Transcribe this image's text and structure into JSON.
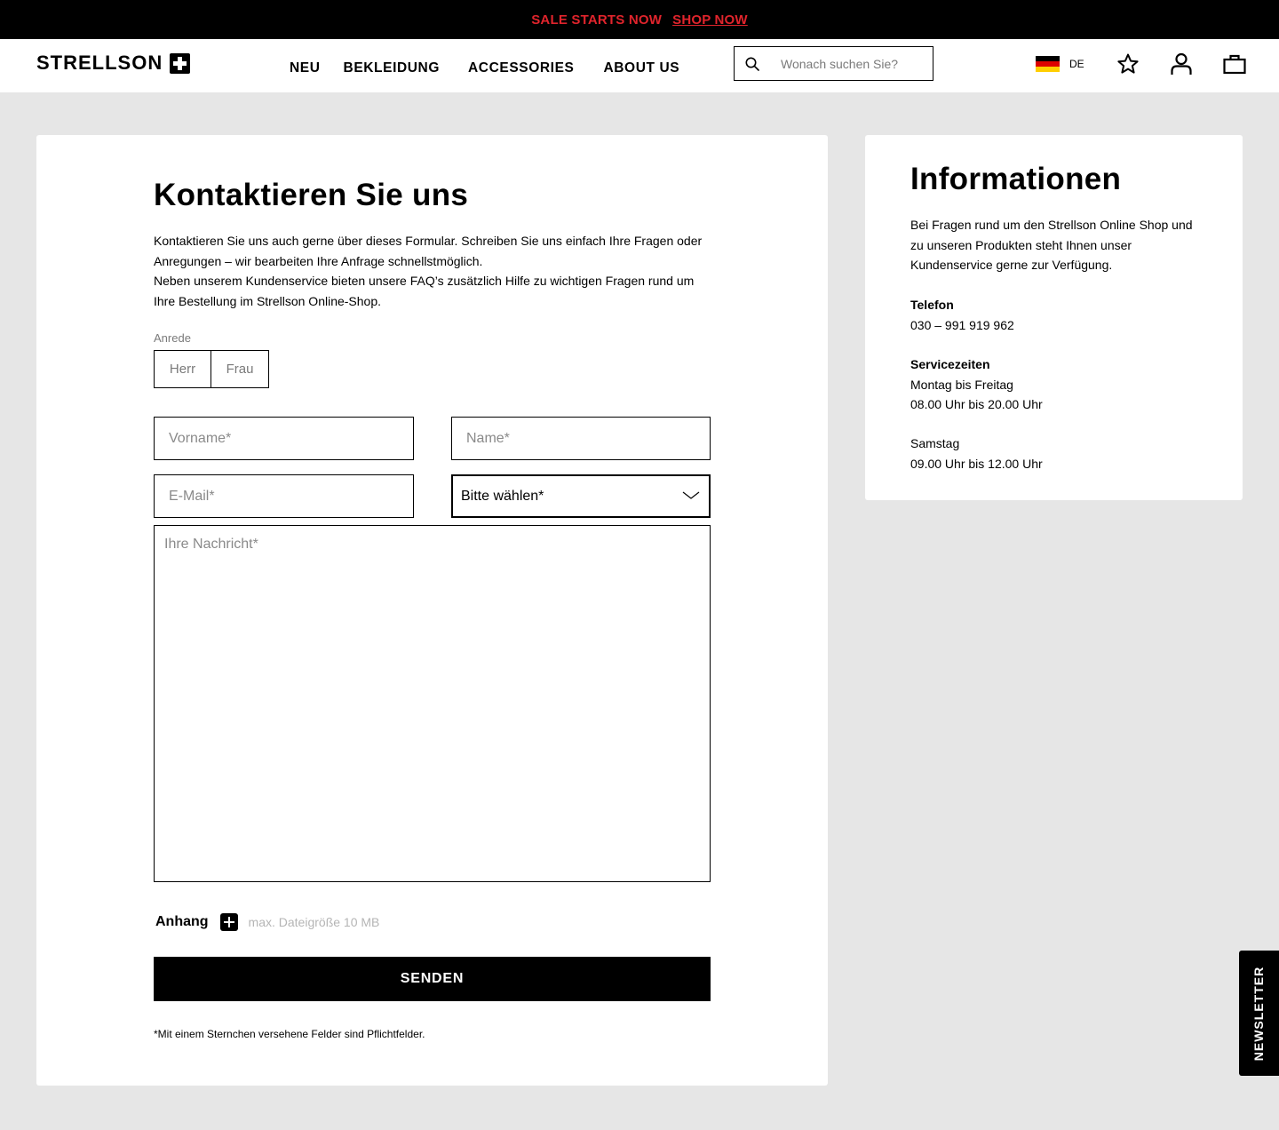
{
  "promo": {
    "sale_text": "SALE STARTS NOW",
    "shop_link": "SHOP NOW",
    "sale_color": "#e0242c"
  },
  "header": {
    "logo": "STRELLSON",
    "nav": [
      "NEU",
      "BEKLEIDUNG",
      "ACCESSORIES",
      "ABOUT US"
    ],
    "search_placeholder": "Wonach suchen Sie?",
    "language": "DE",
    "icons": [
      "search-icon",
      "flag-de-icon",
      "wishlist-star-icon",
      "account-icon",
      "cart-bag-icon"
    ]
  },
  "contact": {
    "title": "Kontaktieren Sie uns",
    "intro_1": "Kontaktieren Sie uns auch gerne über dieses Formular. Schreiben Sie uns einfach Ihre Fragen oder Anregungen – wir bearbeiten Ihre Anfrage schnellstmöglich.",
    "intro_2": "Neben unserem Kundenservice bieten unsere FAQ’s zusätzlich Hilfe zu wichtigen Fragen rund um Ihre Bestellung im Strellson Online-Shop.",
    "salutation_label": "Anrede",
    "salutation_options": [
      "Herr",
      "Frau"
    ],
    "firstname_placeholder": "Vorname*",
    "name_placeholder": "Name*",
    "email_placeholder": "E-Mail*",
    "topic_select_value": "Bitte wählen*",
    "message_placeholder": "Ihre Nachricht*",
    "attachment_label": "Anhang",
    "attachment_hint": "max. Dateigröße 10 MB",
    "submit_label": "SENDEN",
    "footnote": "*Mit einem Sternchen versehene Felder sind Pflichtfelder."
  },
  "info": {
    "title": "Informationen",
    "body": "Bei Fragen rund um den Strellson Online Shop und zu unseren Produkten steht Ihnen unser Kundenservice gerne zur Verfügung.",
    "phone_heading": "Telefon",
    "phone": "030 – 991 919 962",
    "hours_heading": "Servicezeiten",
    "weekday_days": "Montag bis Freitag",
    "weekday_hours": "08.00 Uhr bis 20.00 Uhr",
    "saturday_days": "Samstag",
    "saturday_hours": "09.00 Uhr bis 12.00 Uhr"
  },
  "newsletter_tab": "NEWSLETTER"
}
